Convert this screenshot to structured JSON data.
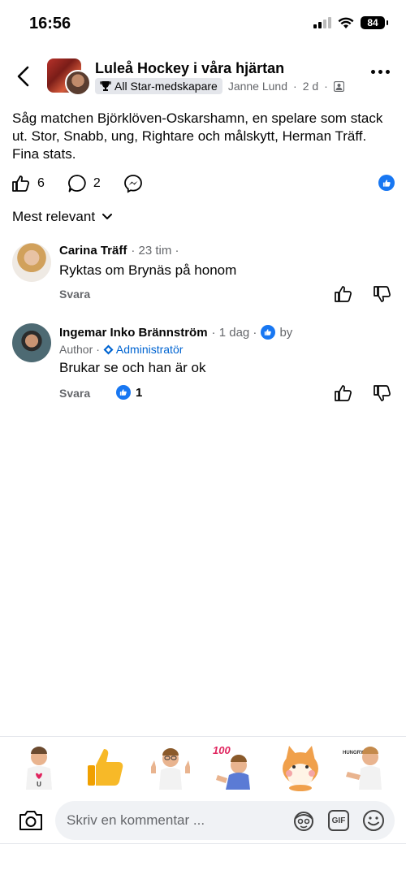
{
  "status_bar": {
    "time": "16:56",
    "battery": "84"
  },
  "header": {
    "group_title": "Luleå Hockey i våra hjärtan",
    "badge": "All Star-medskapare",
    "author": "Janne Lund",
    "time": "2 d"
  },
  "post": {
    "text": "Såg matchen Björklöven-Oskarshamn, en spelare som stack ut. Stor, Snabb, ung, Rightare och målskytt, Herman Träff. Fina stats.",
    "likes": "6",
    "comments": "2"
  },
  "sort": {
    "label": "Mest relevant"
  },
  "comments": [
    {
      "name": "Carina Träff",
      "time": "23 tim",
      "text": "Ryktas om Brynäs på honom",
      "reply": "Svara"
    },
    {
      "name": "Ingemar Inko Brännström",
      "time": "1 dag",
      "by": "by",
      "role_author": "Author",
      "role_admin": "Administratör",
      "text": "Brukar se och han är ok",
      "reply": "Svara",
      "reactions": "1"
    }
  ],
  "composer": {
    "placeholder": "Skriv en kommentar ...",
    "gif_label": "GIF"
  },
  "sticker_text": {
    "sticker_3": "100",
    "sticker_6": "HUNGRY?"
  },
  "icons": [
    "back-chevron-icon",
    "trophy-icon",
    "group-members-icon",
    "more-icon",
    "like-icon",
    "comment-icon",
    "messenger-icon",
    "like-badge-icon",
    "chevron-down-icon",
    "thumb-up-icon",
    "thumb-down-icon",
    "diamond-icon",
    "camera-icon",
    "avatar-sticker-icon",
    "gif-icon",
    "emoji-icon"
  ],
  "colors": {
    "accent": "#1877f2",
    "admin": "#0064d1",
    "secondary_text": "#65676b",
    "input_bg": "#f0f2f5"
  }
}
